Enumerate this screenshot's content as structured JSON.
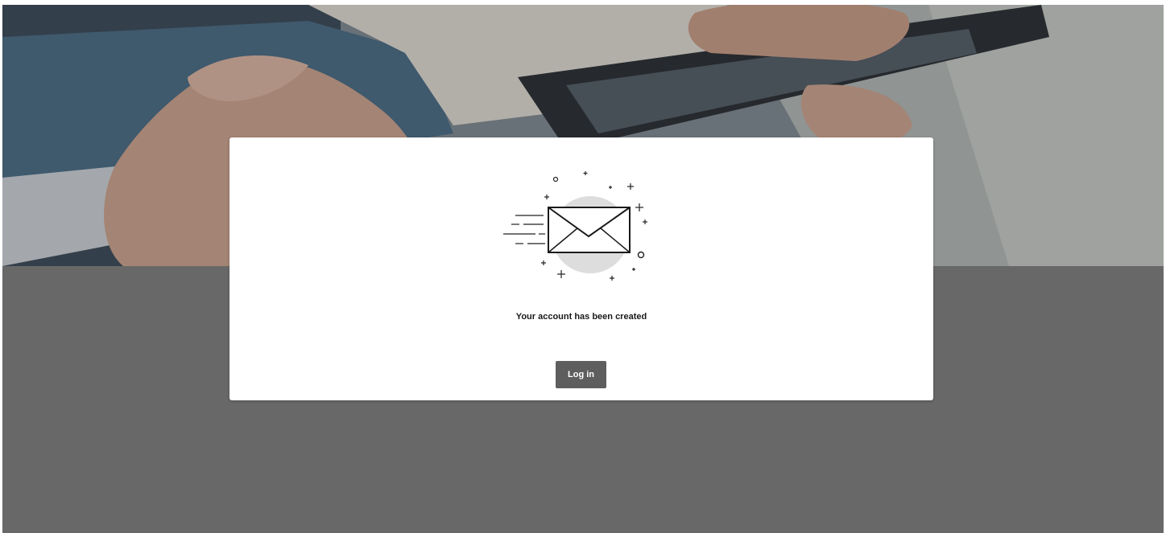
{
  "hero": {
    "image": "hands-holding-smartphone-photo"
  },
  "confirmation": {
    "illustration": "mail-sent-icon",
    "message": "Your account has been created",
    "login_label": "Log in"
  },
  "colors": {
    "page_background": "#686868",
    "card_background": "#ffffff",
    "button_background": "#5e5e5e",
    "button_text": "#ffffff",
    "message_text": "#1a1a1a",
    "illustration_circle": "#dddddd"
  }
}
